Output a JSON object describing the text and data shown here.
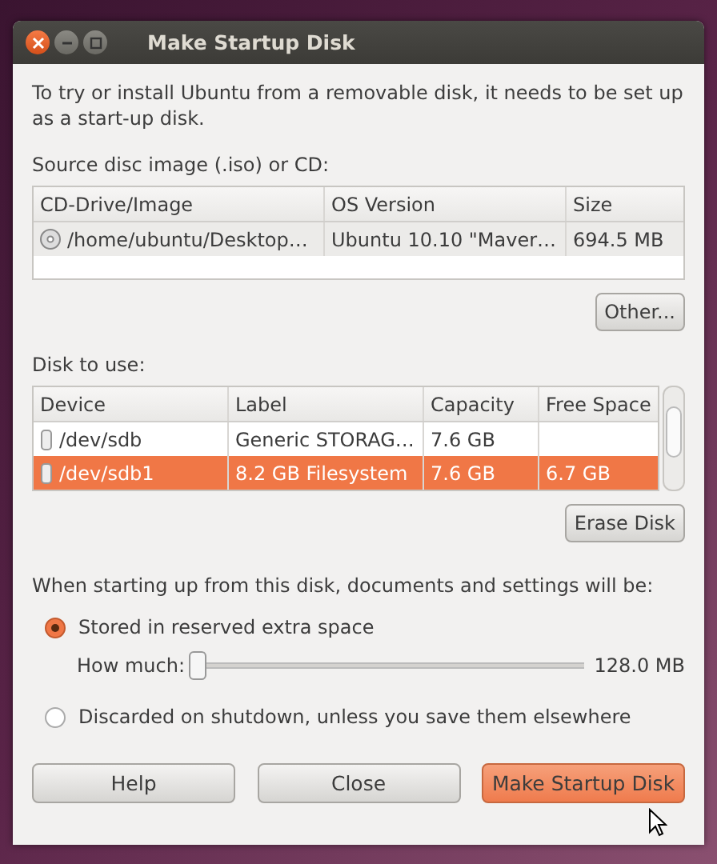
{
  "window": {
    "title": "Make Startup Disk"
  },
  "intro": "To try or install Ubuntu from a removable disk, it needs to be set up as a start-up disk.",
  "source": {
    "label": "Source disc image (.iso) or CD:",
    "columns": [
      "CD-Drive/Image",
      "OS Version",
      "Size"
    ],
    "rows": [
      {
        "cells": [
          "/home/ubuntu/Desktop…",
          "Ubuntu 10.10 \"Maver…",
          "694.5 MB"
        ],
        "selected": false
      }
    ],
    "button": "Other..."
  },
  "disk": {
    "label": "Disk to use:",
    "columns": [
      "Device",
      "Label",
      "Capacity",
      "Free Space"
    ],
    "rows": [
      {
        "cells": [
          "/dev/sdb",
          "Generic STORAG…",
          "7.6 GB",
          ""
        ],
        "selected": false
      },
      {
        "cells": [
          "/dev/sdb1",
          "8.2 GB Filesystem",
          "7.6 GB",
          "6.7 GB"
        ],
        "selected": true
      }
    ],
    "button": "Erase Disk"
  },
  "persistence": {
    "label": "When starting up from this disk, documents and settings will be:",
    "options": [
      {
        "label": "Stored in reserved extra space",
        "selected": true
      },
      {
        "label": "Discarded on shutdown, unless you save them elsewhere",
        "selected": false
      }
    ],
    "slider": {
      "label": "How much:",
      "level": 0.01,
      "reading": "128.0 MB"
    }
  },
  "buttons": [
    {
      "label": "Help",
      "kind": "normal"
    },
    {
      "label": "Close",
      "kind": "normal"
    },
    {
      "label": "Make Startup Disk",
      "kind": "default"
    }
  ]
}
